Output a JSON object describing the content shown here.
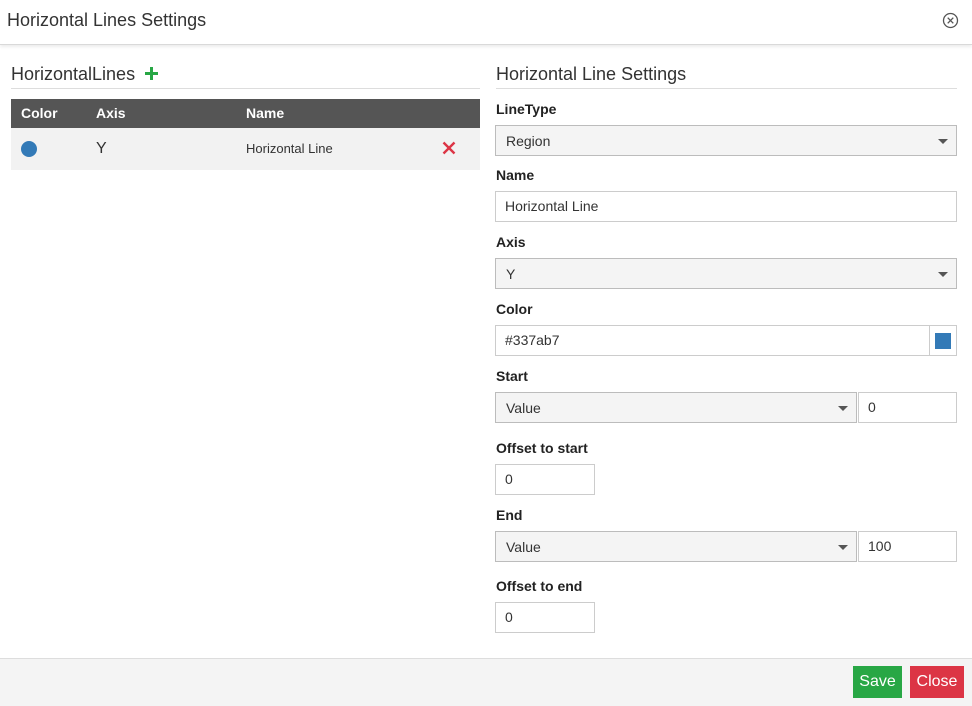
{
  "dialog": {
    "title": "Horizontal Lines Settings"
  },
  "left": {
    "title": "HorizontalLines",
    "table": {
      "headers": [
        "Color",
        "Axis",
        "Name"
      ],
      "rows": [
        {
          "color": "#337ab7",
          "axis": "Y",
          "name": "Horizontal Line"
        }
      ]
    }
  },
  "right": {
    "title": "Horizontal Line Settings",
    "line_type": {
      "label": "LineType",
      "value": "Region"
    },
    "name": {
      "label": "Name",
      "value": "Horizontal Line"
    },
    "axis": {
      "label": "Axis",
      "value": "Y"
    },
    "color": {
      "label": "Color",
      "value": "#337ab7"
    },
    "start": {
      "label": "Start",
      "mode": "Value",
      "value": "0"
    },
    "offset_start": {
      "label": "Offset to start",
      "value": "0"
    },
    "end": {
      "label": "End",
      "mode": "Value",
      "value": "100"
    },
    "offset_end": {
      "label": "Offset to end",
      "value": "0"
    }
  },
  "footer": {
    "save_label": "Save",
    "close_label": "Close"
  },
  "colors": {
    "accent": "#337ab7",
    "add": "#28a745",
    "danger": "#dc3545",
    "table_header": "#555555"
  }
}
